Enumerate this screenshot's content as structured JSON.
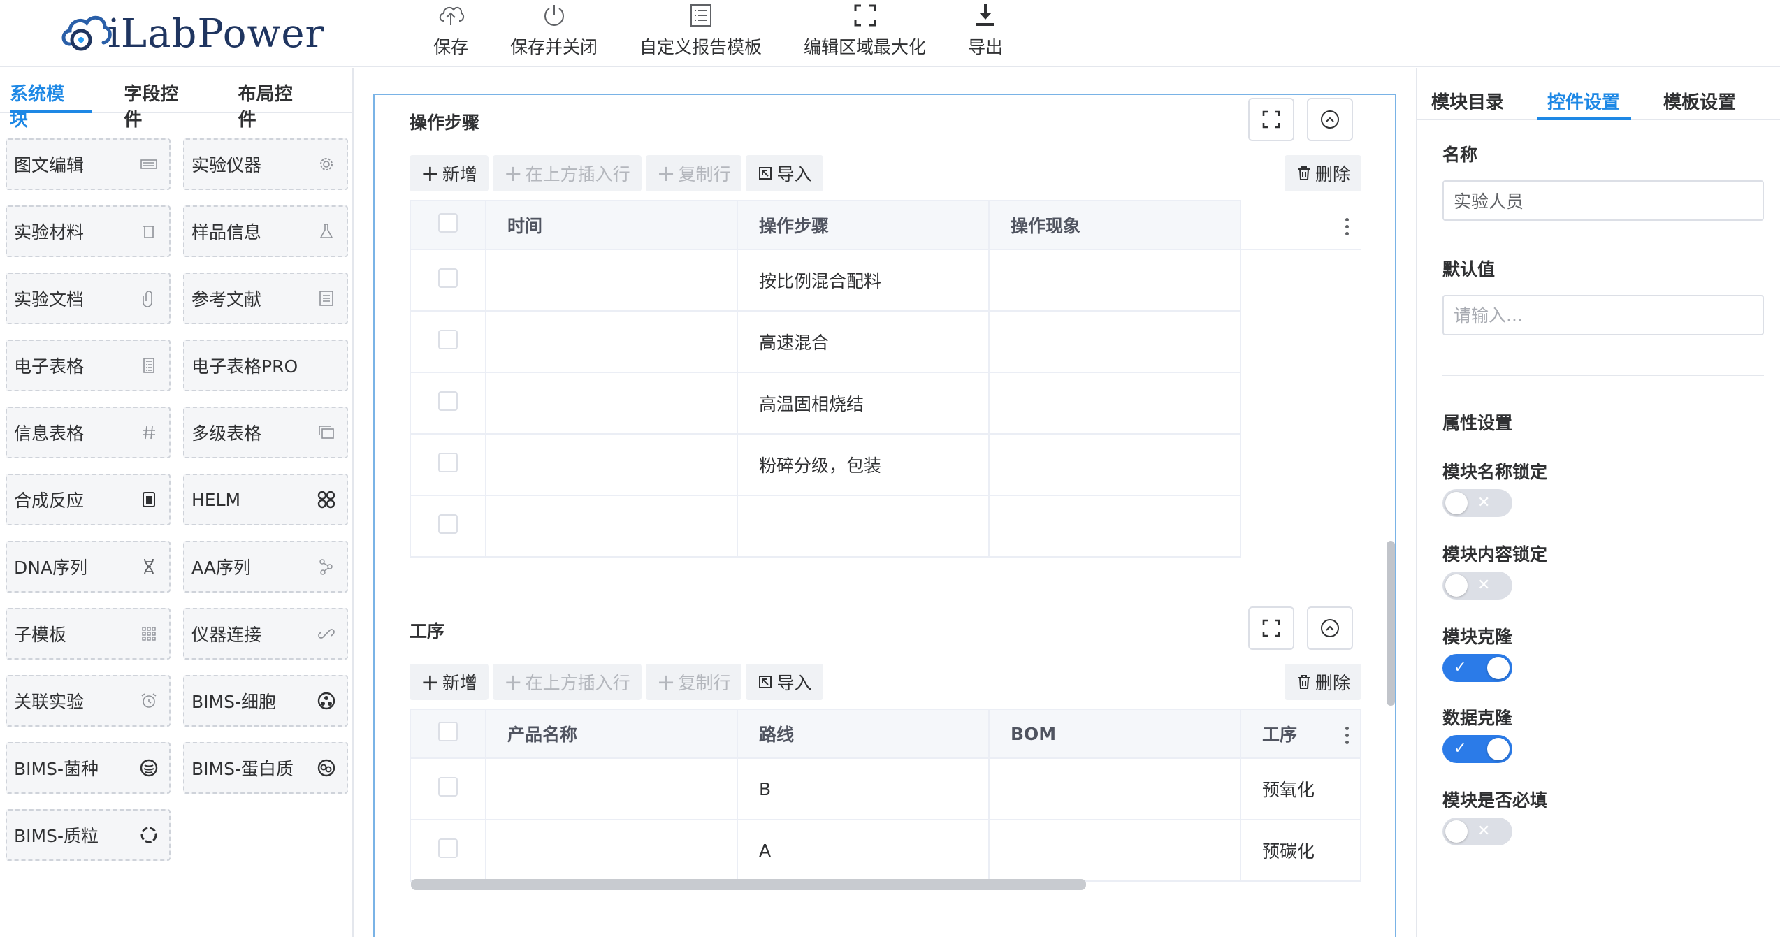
{
  "app": {
    "logo_text": "iLabPower",
    "brand_color": "#1e3a6b",
    "accent_color": "#1e88e5"
  },
  "toolbar": [
    {
      "label": "保存",
      "icon": "cloud-upload-icon"
    },
    {
      "label": "保存并关闭",
      "icon": "power-icon"
    },
    {
      "label": "自定义报告模板",
      "icon": "list-document-icon"
    },
    {
      "label": "编辑区域最大化",
      "icon": "maximize-icon"
    },
    {
      "label": "导出",
      "icon": "download-icon"
    }
  ],
  "left_panel": {
    "tabs": [
      {
        "label": "系统模块",
        "active": true
      },
      {
        "label": "字段控件",
        "active": false
      },
      {
        "label": "布局控件",
        "active": false
      }
    ],
    "modules": [
      {
        "label": "图文编辑",
        "icon": "keyboard-icon"
      },
      {
        "label": "实验仪器",
        "icon": "gear-icon"
      },
      {
        "label": "实验材料",
        "icon": "trash-can-icon"
      },
      {
        "label": "样品信息",
        "icon": "flask-icon"
      },
      {
        "label": "实验文档",
        "icon": "paperclip-icon"
      },
      {
        "label": "参考文献",
        "icon": "document-list-icon"
      },
      {
        "label": "电子表格",
        "icon": "calculator-icon"
      },
      {
        "label": "电子表格PRO",
        "icon": ""
      },
      {
        "label": "信息表格",
        "icon": "hash-icon"
      },
      {
        "label": "多级表格",
        "icon": "stacked-windows-icon"
      },
      {
        "label": "合成反应",
        "icon": "reactor-icon"
      },
      {
        "label": "HELM",
        "icon": "helm-icon"
      },
      {
        "label": "DNA序列",
        "icon": "dna-icon"
      },
      {
        "label": "AA序列",
        "icon": "molecule-icon"
      },
      {
        "label": "子模板",
        "icon": "dot-grid-icon"
      },
      {
        "label": "仪器连接",
        "icon": "link-icon"
      },
      {
        "label": "关联实验",
        "icon": "alarm-clock-icon"
      },
      {
        "label": "BIMS-细胞",
        "icon": "cell-icon"
      },
      {
        "label": "BIMS-菌种",
        "icon": "bacteria-icon"
      },
      {
        "label": "BIMS-蛋白质",
        "icon": "protein-icon"
      },
      {
        "label": "BIMS-质粒",
        "icon": "plasmid-icon"
      }
    ]
  },
  "sections": [
    {
      "title": "操作步骤",
      "buttons": {
        "add": "新增",
        "insert_above": "在上方插入行",
        "copy_row": "复制行",
        "import": "导入",
        "delete": "删除"
      },
      "columns": [
        "时间",
        "操作步骤",
        "操作现象"
      ],
      "rows": [
        [
          "",
          "按比例混合配料",
          ""
        ],
        [
          "",
          "高速混合",
          ""
        ],
        [
          "",
          "高温固相烧结",
          ""
        ],
        [
          "",
          "粉碎分级，包装",
          ""
        ],
        [
          "",
          "",
          ""
        ]
      ]
    },
    {
      "title": "工序",
      "buttons": {
        "add": "新增",
        "insert_above": "在上方插入行",
        "copy_row": "复制行",
        "import": "导入",
        "delete": "删除"
      },
      "columns": [
        "产品名称",
        "路线",
        "BOM",
        "工序"
      ],
      "rows": [
        [
          "",
          "B",
          "",
          "预氧化"
        ],
        [
          "",
          "A",
          "",
          "预碳化"
        ]
      ]
    }
  ],
  "right_panel": {
    "tabs": [
      {
        "label": "模块目录",
        "active": false
      },
      {
        "label": "控件设置",
        "active": true
      },
      {
        "label": "模板设置",
        "active": false
      }
    ],
    "name_label": "名称",
    "name_value": "实验人员",
    "default_label": "默认值",
    "default_placeholder": "请输入...",
    "props_title": "属性设置",
    "switches": [
      {
        "label": "模块名称锁定",
        "on": false
      },
      {
        "label": "模块内容锁定",
        "on": false
      },
      {
        "label": "模块克隆",
        "on": true
      },
      {
        "label": "数据克隆",
        "on": true
      },
      {
        "label": "模块是否必填",
        "on": false
      }
    ]
  }
}
